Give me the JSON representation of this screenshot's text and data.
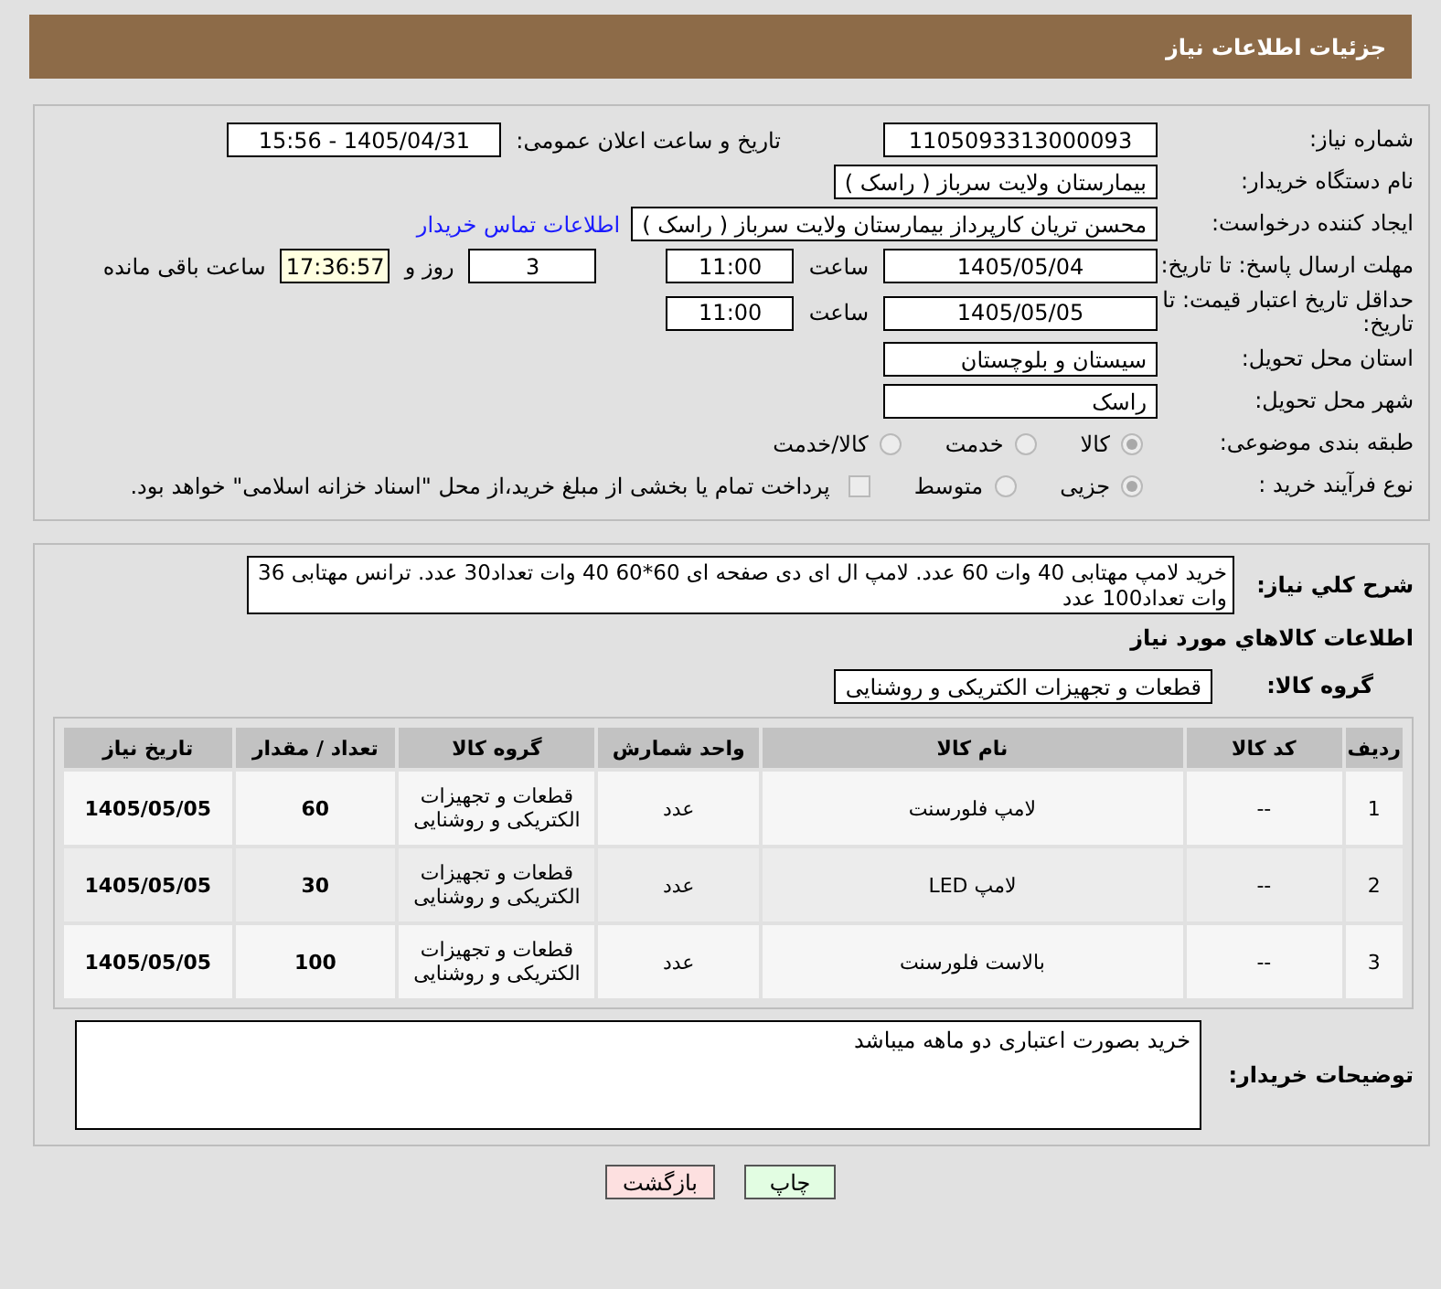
{
  "header": {
    "title": "جزئیات اطلاعات نیاز"
  },
  "need_number": {
    "label": "شماره نیاز:",
    "value": "1105093313000093"
  },
  "announce": {
    "label": "تاریخ و ساعت اعلان عمومی:",
    "value": "1405/04/31 - 15:56"
  },
  "buyer_org": {
    "label": "نام دستگاه خریدار:",
    "value": "بیمارستان ولایت سرباز ( راسک )"
  },
  "requester": {
    "label": "ایجاد کننده درخواست:",
    "value": "محسن تریان کارپرداز بیمارستان ولایت سرباز ( راسک )",
    "link": "اطلاعات تماس خریدار"
  },
  "reply_deadline": {
    "label": "مهلت ارسال پاسخ: تا تاریخ:",
    "date": "1405/05/04",
    "time_label": "ساعت",
    "time": "11:00",
    "days": "3",
    "days_label": "روز و",
    "remaining": "17:36:57",
    "remaining_label": "ساعت باقی مانده"
  },
  "price_validity": {
    "label": "حداقل تاریخ اعتبار قیمت: تا تاریخ:",
    "date": "1405/05/05",
    "time_label": "ساعت",
    "time": "11:00"
  },
  "province": {
    "label": "استان محل تحویل:",
    "value": "سیستان و بلوچستان"
  },
  "city": {
    "label": "شهر محل تحویل:",
    "value": "راسک"
  },
  "category": {
    "label": "طبقه بندی موضوعی:",
    "options": [
      {
        "label": "کالا",
        "selected": true
      },
      {
        "label": "خدمت",
        "selected": false
      },
      {
        "label": "کالا/خدمت",
        "selected": false
      }
    ]
  },
  "process": {
    "label": "نوع فرآیند خرید :",
    "options": [
      {
        "label": "جزیی",
        "selected": true
      },
      {
        "label": "متوسط",
        "selected": false
      }
    ],
    "treasury": {
      "checked": false,
      "text": "پرداخت تمام یا بخشی از مبلغ خرید،از محل \"اسناد خزانه اسلامی\" خواهد بود."
    }
  },
  "description": {
    "label": "شرح کلي نياز:",
    "value": "خرید لامپ مهتابی 40 وات 60 عدد. لامپ ال ای دی صفحه ای 60*60  40 وات تعداد30 عدد. ترانس مهتابی 36 وات تعداد100 عدد"
  },
  "goods_heading": "اطلاعات کالاهاي مورد نياز",
  "goods_group": {
    "label": "گروه کالا:",
    "value": "قطعات و تجهیزات الکتریکی و روشنایی"
  },
  "table": {
    "columns": [
      "ردیف",
      "کد کالا",
      "نام کالا",
      "واحد شمارش",
      "گروه کالا",
      "تعداد / مقدار",
      "تاریخ نیاز"
    ],
    "rows": [
      [
        "1",
        "--",
        "لامپ فلورسنت",
        "عدد",
        "قطعات و تجهیزات الکتریکی و روشنایی",
        "60",
        "1405/05/05"
      ],
      [
        "2",
        "--",
        "لامپ LED",
        "عدد",
        "قطعات و تجهیزات الکتریکی و روشنایی",
        "30",
        "1405/05/05"
      ],
      [
        "3",
        "--",
        "بالاست فلورسنت",
        "عدد",
        "قطعات و تجهیزات الکتریکی و روشنایی",
        "100",
        "1405/05/05"
      ]
    ]
  },
  "buyer_notes": {
    "label": "توضیحات خریدار:",
    "value": "خرید بصورت اعتباری دو ماهه میباشد"
  },
  "buttons": [
    {
      "label": "چاپ",
      "kind": "print"
    },
    {
      "label": "بازگشت",
      "kind": "back"
    }
  ]
}
